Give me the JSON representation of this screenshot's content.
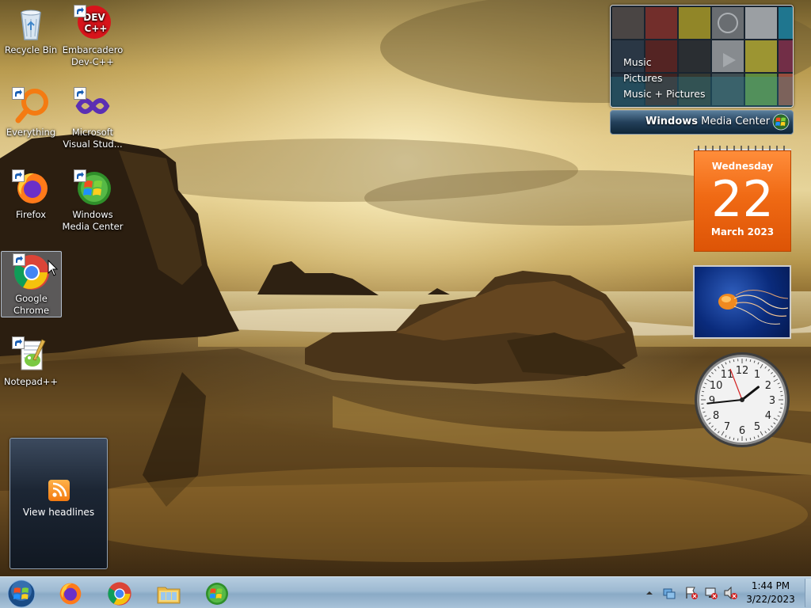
{
  "desktop_icons": [
    {
      "label": "Recycle Bin"
    },
    {
      "label": "Embarcadero Dev-C++",
      "icon_text": "DEV C++"
    },
    {
      "label": "Everything"
    },
    {
      "label": "Microsoft Visual Stud..."
    },
    {
      "label": "Firefox"
    },
    {
      "label": "Windows Media Center"
    },
    {
      "label": "Google Chrome"
    },
    {
      "label": "Notepad++"
    }
  ],
  "gadgets": {
    "media_center": {
      "menu": [
        "Music",
        "Pictures",
        "Music + Pictures"
      ],
      "bar_title_bold": "Windows",
      "bar_title_rest": " Media Center"
    },
    "calendar": {
      "weekday": "Wednesday",
      "day": "22",
      "month_year": "March 2023"
    },
    "clock": {
      "numerals": [
        "12",
        "1",
        "2",
        "3",
        "4",
        "5",
        "6",
        "7",
        "8",
        "9",
        "10",
        "11"
      ],
      "time": "1:44"
    },
    "feed": {
      "label": "View headlines"
    }
  },
  "taskbar": {
    "pinned": [
      "Firefox",
      "Google Chrome",
      "Windows Explorer",
      "Windows Media Center"
    ],
    "tray": {
      "time": "1:44 PM",
      "date": "3/22/2023"
    }
  },
  "colors": {
    "calendar_orange": "#f06a14",
    "taskbar": "#9db9d1"
  }
}
